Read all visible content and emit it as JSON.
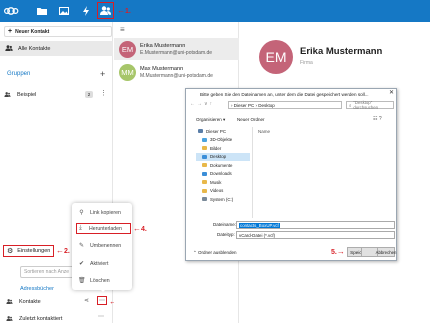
{
  "topbar": {
    "bg": "#1578c5",
    "icons": [
      "nextcloud-logo-icon",
      "files-icon",
      "photos-icon",
      "activity-icon",
      "contacts-icon"
    ],
    "step_label": "1."
  },
  "sidebar": {
    "new_contact_label": "Neuer Kontakt",
    "all_contacts_label": "Alle Kontakte",
    "groups_heading": "Gruppen",
    "groups": [
      {
        "label": "Beispiel",
        "count": "2"
      }
    ],
    "settings_label": "Einstellungen",
    "settings_step": "2.",
    "sort_placeholder": "Sortieren nach Anze",
    "addressbooks_heading": "Adressbücher",
    "addressbooks": [
      {
        "label": "Kontakte"
      },
      {
        "label": "Zuletzt kontaktiert"
      }
    ],
    "more_step": "3."
  },
  "contact_list": {
    "contacts": [
      {
        "initials": "EM",
        "name": "Erika Mustermann",
        "email": "E.Mustermann@uni-potsdam.de",
        "color": "#c46478"
      },
      {
        "initials": "MM",
        "name": "Max Mustermann",
        "email": "M.Mustermann@uni-potsdam.de",
        "color": "#a7c66a"
      }
    ]
  },
  "details": {
    "initials": "EM",
    "name": "Erika Mustermann",
    "company_placeholder": "Firma"
  },
  "context_menu": {
    "items": [
      {
        "label": "Link kopieren",
        "icon": "link-icon"
      },
      {
        "label": "Herunterladen",
        "icon": "download-icon"
      },
      {
        "label": "Umbenennen",
        "icon": "pencil-icon"
      },
      {
        "label": "Aktiviert",
        "icon": "check-icon"
      },
      {
        "label": "Löschen",
        "icon": "trash-icon"
      }
    ],
    "download_step": "4."
  },
  "save_dialog": {
    "title": "Bitte geben Sie den Dateinamen an, unter dem die Datei gespeichert werden soll...",
    "path": "› Dieser PC › Desktop",
    "search_placeholder": "\"Desktop\" durchsuchen",
    "organize_label": "Organisieren ▾",
    "new_folder_label": "Neuer Ordner",
    "column_name": "Name",
    "tree": [
      {
        "label": "Dieser PC",
        "color": "#5a7ea8"
      },
      {
        "label": "3D-Objekte",
        "color": "#4aa3df"
      },
      {
        "label": "Bilder",
        "color": "#e8b84a"
      },
      {
        "label": "Desktop",
        "color": "#3b8ed8",
        "selected": true
      },
      {
        "label": "Dokumente",
        "color": "#e8b84a"
      },
      {
        "label": "Downloads",
        "color": "#3b8ed8"
      },
      {
        "label": "Musik",
        "color": "#e8b84a"
      },
      {
        "label": "Videos",
        "color": "#e8b84a"
      },
      {
        "label": "System (C:)",
        "color": "#7a8a99"
      }
    ],
    "filename_label": "Dateiname:",
    "filename_value": "contacts_BoxUP.vcf",
    "filetype_label": "Dateityp:",
    "filetype_value": "vCard-Datei (*.vcf)",
    "hide_folders_label": "Ordner ausblenden",
    "save_label": "Speichern",
    "cancel_label": "Abbrechen",
    "save_step": "5."
  }
}
